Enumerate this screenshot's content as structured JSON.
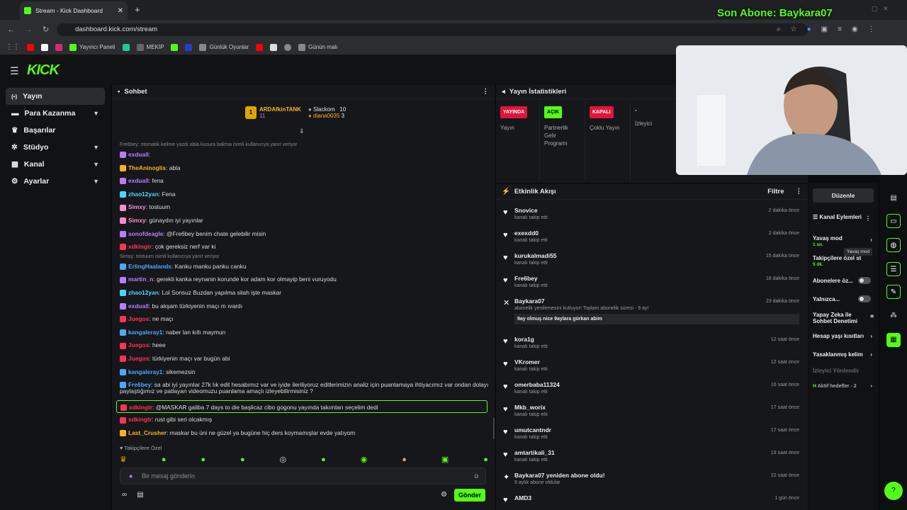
{
  "browser": {
    "tab_title": "Stream - Kick Dashboard",
    "url": "dashboard.kick.com/stream",
    "bookmarks": [
      "Yayıncı Paneli",
      "MEKİP",
      "Günlük Oyunlar",
      "Günün malı"
    ],
    "overlay_text": "Son Abone: Baykara07"
  },
  "app": {
    "logo": "KICK"
  },
  "sidebar": {
    "items": [
      {
        "label": "Yayın",
        "icon": "broadcast-icon",
        "active": true
      },
      {
        "label": "Para Kazanma",
        "icon": "money-icon"
      },
      {
        "label": "Başarılar",
        "icon": "trophy-icon"
      },
      {
        "label": "Stüdyo",
        "icon": "gear-icon"
      },
      {
        "label": "Kanal",
        "icon": "grid-icon"
      },
      {
        "label": "Ayarlar",
        "icon": "settings-icon"
      }
    ]
  },
  "chat": {
    "title": "Sohbet",
    "leaderboard": {
      "top": {
        "name": "ARDAfkinTANK",
        "count": "11"
      },
      "second": {
        "name": "Slackom",
        "count": "10"
      },
      "third": {
        "name": "diana0035",
        "count": "3"
      }
    },
    "system1": "Fre6bey: otomatik kelime yazdı abla kusura bakma isimli kullanıcıya yanıt veriyor",
    "system2": "Simxy: tostuum isimli kullanıcıya yanıt veriyor",
    "messages": [
      {
        "user": "exduall",
        "text": ":",
        "color": "#b97cff"
      },
      {
        "user": "TheAninoglis",
        "text": ": abla",
        "color": "#ffb020"
      },
      {
        "user": "exduall",
        "text": ": fena",
        "color": "#b97cff"
      },
      {
        "user": "zhao12yan",
        "text": ": Fena",
        "color": "#4ad6ff"
      },
      {
        "user": "Simxy",
        "text": ": tostuum",
        "color": "#ff8ad0"
      },
      {
        "user": "Simxy",
        "text": ": günaydın iyi yayınlar",
        "color": "#ff8ad0"
      },
      {
        "user": "sonofdeagle",
        "text": ": @Fre6bey benim chate gelebilir misin",
        "color": "#b97cff"
      },
      {
        "user": "xdkingtr",
        "text": ": çok gereksiz nerf var ki",
        "color": "#ff3355"
      },
      {
        "user": "ErlingHaalands",
        "text": ": Kanku manku panku canku",
        "color": "#4aa8ff"
      },
      {
        "user": "martin_n",
        "text": ": gerekli kanka reynanin korunde kor adam kor olmayip beni vuruyodu",
        "color": "#b97cff"
      },
      {
        "user": "zhao12yan",
        "text": ": Lol Sonsuz Buzdan yapılma silah işte maskar",
        "color": "#4ad6ff"
      },
      {
        "user": "exduall",
        "text": ": bu akşam türkiyenin maçı m ıvardı",
        "color": "#b97cff"
      },
      {
        "user": "Juegos",
        "text": ": ne maçı",
        "color": "#ff3355"
      },
      {
        "user": "kangaleray1",
        "text": ": naber lan kıllı maymun",
        "color": "#4aa8ff"
      },
      {
        "user": "Juegos",
        "text": ": heee",
        "color": "#ff3355"
      },
      {
        "user": "Juegos",
        "text": ": türkiyenin maçı var bugün abi",
        "color": "#ff3355"
      },
      {
        "user": "kangaleray1",
        "text": ": sikemezsin",
        "color": "#4aa8ff"
      },
      {
        "user": "Fre6bey",
        "text": ": sa abi iyi yayınlar 27k lık edit hesabımız var ve iyide ileriliyoruz editlerimizin analiz için puanlamaya ihtiyacımız var ondan dolayı",
        "color": "#4aa8ff"
      },
      {
        "user": "",
        "text": "paylaştığımız ve patlayan videomuzu puanlama amaçlı izleyebilirmisiniz ?",
        "color": "#ddd"
      },
      {
        "user": "xdkingtr",
        "text": ": @MASKAR galiba 7 days to die başlicaz cibo gogonu yayında takımları seçelim dedi",
        "color": "#ff3355"
      },
      {
        "user": "xdkingtr",
        "text": ": rust gibi seri olcakmış",
        "color": "#ff3355"
      },
      {
        "user": "Last_Crusher",
        "text": ": maskar bu üni ne güzel ya bugüne hiç ders koymamışlar evde yatıyom",
        "color": "#ffb020"
      }
    ],
    "followers_only": "Takipçilere Özel",
    "input_placeholder": "Bir mesaj gönderin",
    "send_label": "Gönder"
  },
  "stats": {
    "title": "Yayın İstatistikleri",
    "cols": [
      {
        "pill": "YAYINDA",
        "pill_color": "#e1143c",
        "label": "Yayın"
      },
      {
        "pill": "AÇIK",
        "pill_color": "#53fc18",
        "label": "Partnerlik Gelir Programı"
      },
      {
        "pill": "KAPALI",
        "pill_color": "#e1143c",
        "label": "Çoklu Yayın"
      },
      {
        "pill": "-",
        "pill_color": "",
        "label": "İzleyici"
      }
    ]
  },
  "events": {
    "title": "Etkinlik Akışı",
    "filter": "Filtre",
    "items": [
      {
        "name": "Snovice",
        "sub": "kanalı takip etti",
        "time": "2 dakika önce"
      },
      {
        "name": "exexdd0",
        "sub": "kanalı takip etti",
        "time": "2 dakika önce"
      },
      {
        "name": "kurukalmadi55",
        "sub": "kanalı takip etti",
        "time": "15 dakika önce"
      },
      {
        "name": "Fre6bey",
        "sub": "kanalı takip etti",
        "time": "18 dakika önce"
      },
      {
        "name": "Baykara07",
        "sub": "abonelik yenilemesini kutluyor! Toplam abonelik süresi - 9 ay!",
        "time": "23 dakika önce",
        "note": "9ay olmuş nice 9aylara gürkan abim"
      },
      {
        "name": "kora1g",
        "sub": "kanalı takip etti",
        "time": "12 saat önce"
      },
      {
        "name": "VKromer",
        "sub": "kanalı takip etti",
        "time": "12 saat önce"
      },
      {
        "name": "omerbaba11324",
        "sub": "kanalı takip etti",
        "time": "16 saat önce"
      },
      {
        "name": "Mkb_worix",
        "sub": "kanalı takip etti",
        "time": "17 saat önce"
      },
      {
        "name": "umutcantndr",
        "sub": "kanalı takip etti",
        "time": "17 saat önce"
      },
      {
        "name": "amtartikali_31",
        "sub": "kanalı takip etti",
        "time": "19 saat önce"
      },
      {
        "name": "Baykara07 yeniden abone oldu!",
        "sub": "9 aylık abone oldular",
        "time": "22 saat önce"
      },
      {
        "name": "AMD3",
        "sub": "",
        "time": "1 gün önce"
      }
    ]
  },
  "actions": {
    "edit": "Düzenle",
    "title": "Kanal Eylemleri",
    "slow_mode": "Yavaş mod",
    "slow_val": "1 sn.",
    "tooltip": "Yavaş mod",
    "followers": "Takipçilere özel st",
    "followers_val": "5 dk.",
    "subs": "Abonelere öz...",
    "only": "Yalnızca...",
    "ai": "Yapay Zeka ile Sohbet Denetimi",
    "age": "Hesap yaşı kısıtları",
    "banned": "Yasaklanmış kelim",
    "redirect": "İzleyici Yönlendir",
    "goals": "Aktif hedefler - 2"
  },
  "colors": {
    "accent": "#53fc18",
    "live": "#e1143c"
  }
}
